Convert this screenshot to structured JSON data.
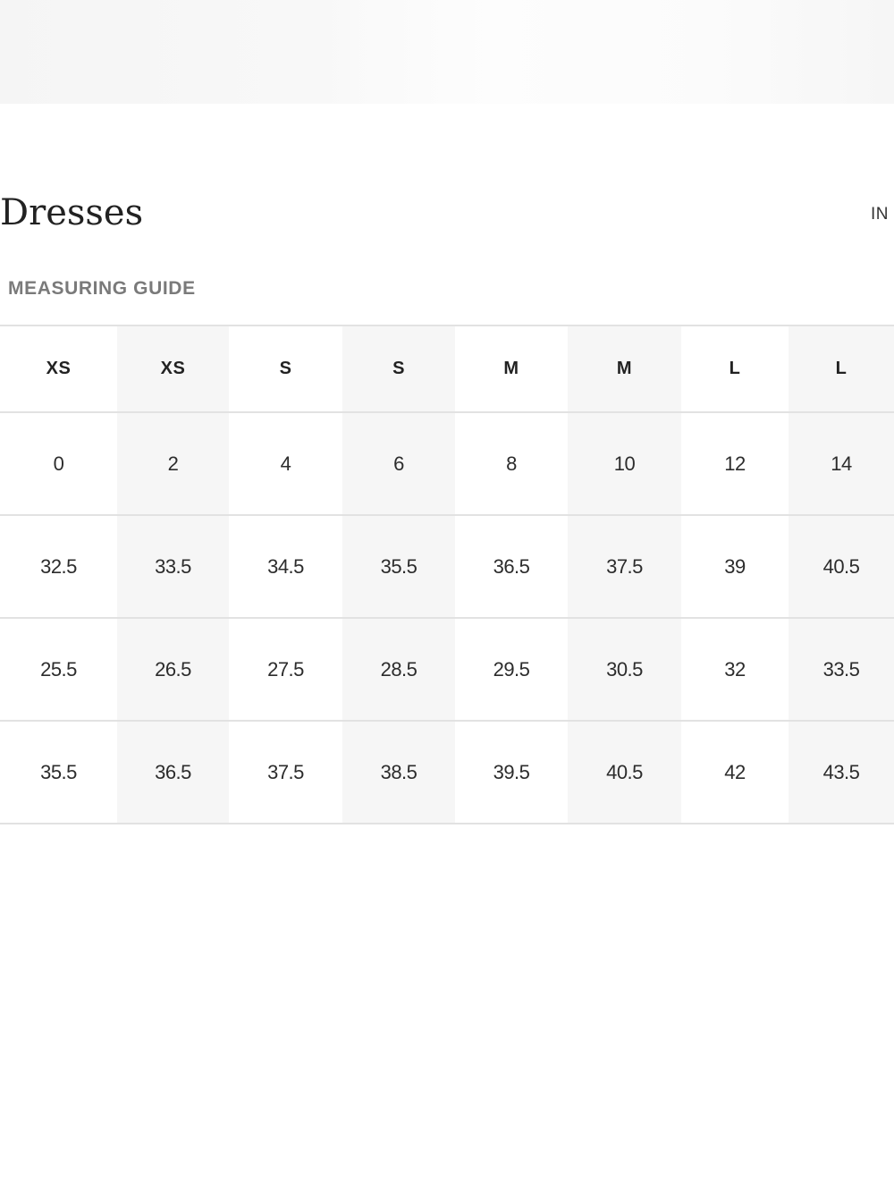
{
  "header": {
    "title": "Dresses",
    "unit": "IN"
  },
  "guide": {
    "label": "MEASURING GUIDE"
  },
  "size_table": {
    "size_labels": [
      "XS",
      "XS",
      "S",
      "S",
      "M",
      "M",
      "L",
      "L"
    ],
    "rows": [
      [
        "0",
        "2",
        "4",
        "6",
        "8",
        "10",
        "12",
        "14"
      ],
      [
        "32.5",
        "33.5",
        "34.5",
        "35.5",
        "36.5",
        "37.5",
        "39",
        "40.5"
      ],
      [
        "25.5",
        "26.5",
        "27.5",
        "28.5",
        "29.5",
        "30.5",
        "32",
        "33.5"
      ],
      [
        "35.5",
        "36.5",
        "37.5",
        "38.5",
        "39.5",
        "40.5",
        "42",
        "43.5"
      ]
    ]
  },
  "colors": {
    "shaded_column": "#f6f6f6",
    "divider": "#e2e2e2",
    "guide_text": "#7a7a7a"
  }
}
